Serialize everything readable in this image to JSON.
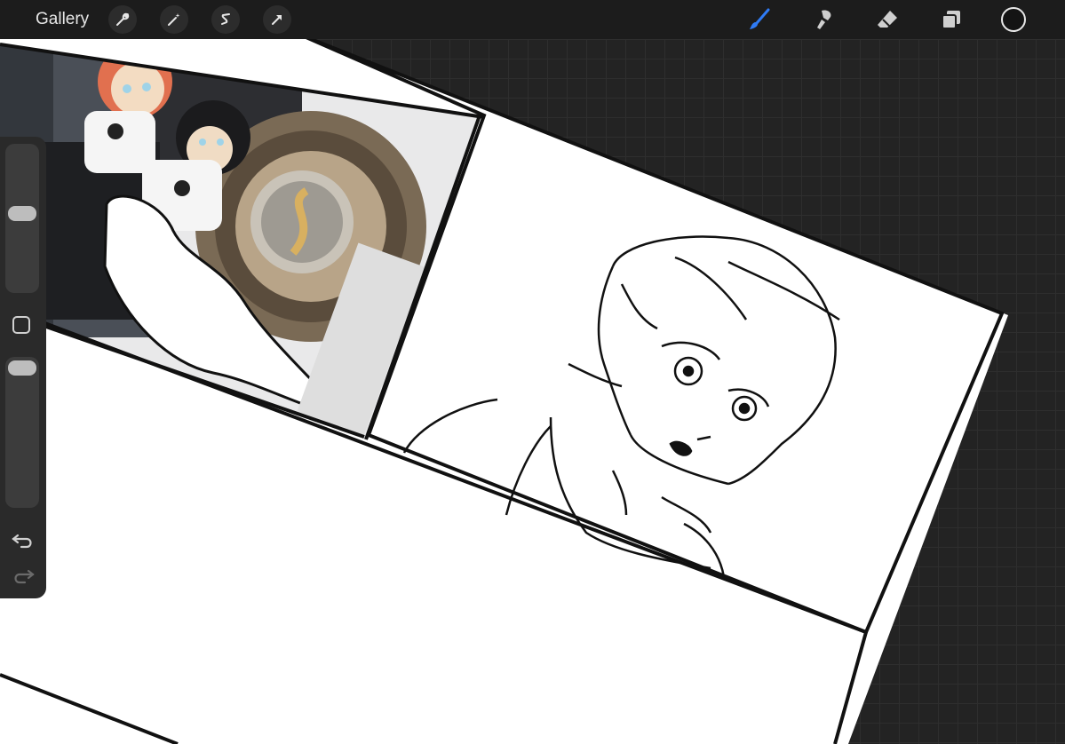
{
  "toolbar": {
    "gallery_label": "Gallery",
    "left_tools": [
      "actions-wrench-icon",
      "adjustments-wand-icon",
      "selection-icon",
      "transform-arrow-icon"
    ],
    "right_tools": [
      "brush-icon",
      "smudge-icon",
      "eraser-icon",
      "layers-icon"
    ],
    "active_tool": "brush",
    "active_tool_color": "#2f7bf5",
    "current_color": "#141414"
  },
  "sidebar": {
    "brush_size_level": 0.55,
    "opacity_level": 0.05,
    "buttons": [
      "modify-square",
      "undo-icon",
      "redo-icon"
    ]
  },
  "canvas": {
    "background": "#232323",
    "page_color": "#ffffff",
    "panel_border_color": "#111111"
  }
}
